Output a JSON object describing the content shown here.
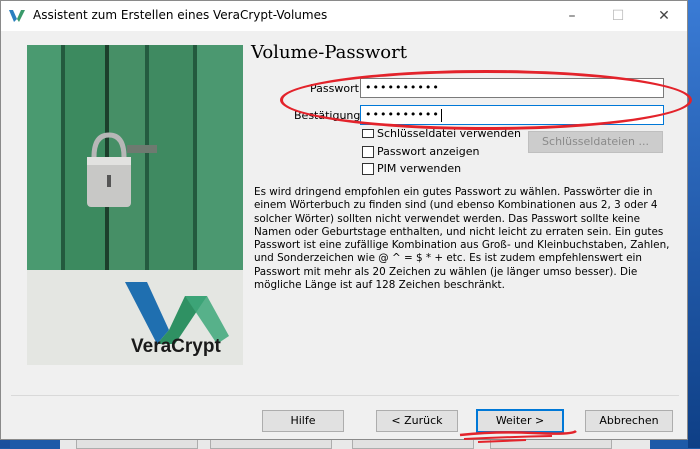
{
  "window": {
    "title": "Assistent zum Erstellen eines VeraCrypt-Volumes",
    "controls": {
      "minimize": "–",
      "maximize": "☐",
      "close": "✕"
    }
  },
  "banner": {
    "brand": "VeraCrypt"
  },
  "page": {
    "heading": "Volume-Passwort",
    "password_label": "Passwort:",
    "password_value": "••••••••••",
    "confirm_label": "Bestätigung:",
    "confirm_value": "••••••••••",
    "keyfiles_checkbox": "Schlüsseldatei verwenden",
    "keyfiles_button": "Schlüsseldateien ...",
    "show_password_checkbox": "Passwort anzeigen",
    "pim_checkbox": "PIM verwenden",
    "info_text": "Es wird dringend empfohlen ein gutes Passwort zu wählen. Passwörter die in einem Wörterbuch zu finden sind (und ebenso Kombinationen aus 2, 3 oder 4 solcher Wörter) sollten nicht verwendet werden. Das Passwort sollte keine Namen oder Geburtstage enthalten, und nicht leicht zu erraten sein. Ein gutes Passwort ist eine zufällige Kombination aus Groß- und Kleinbuchstaben, Zahlen, und Sonderzeichen wie @ ^ = $ * + etc. Es ist zudem empfehlenswert ein Passwort mit mehr als 20 Zeichen zu wählen (je länger umso besser). Die mögliche Länge ist auf 128 Zeichen beschränkt."
  },
  "footer": {
    "help": "Hilfe",
    "back": "< Zurück",
    "next": "Weiter >",
    "cancel": "Abbrechen"
  },
  "colors": {
    "annotation": "#e3232b",
    "focus": "#0078d7",
    "banner_green": "#3f8d64"
  }
}
